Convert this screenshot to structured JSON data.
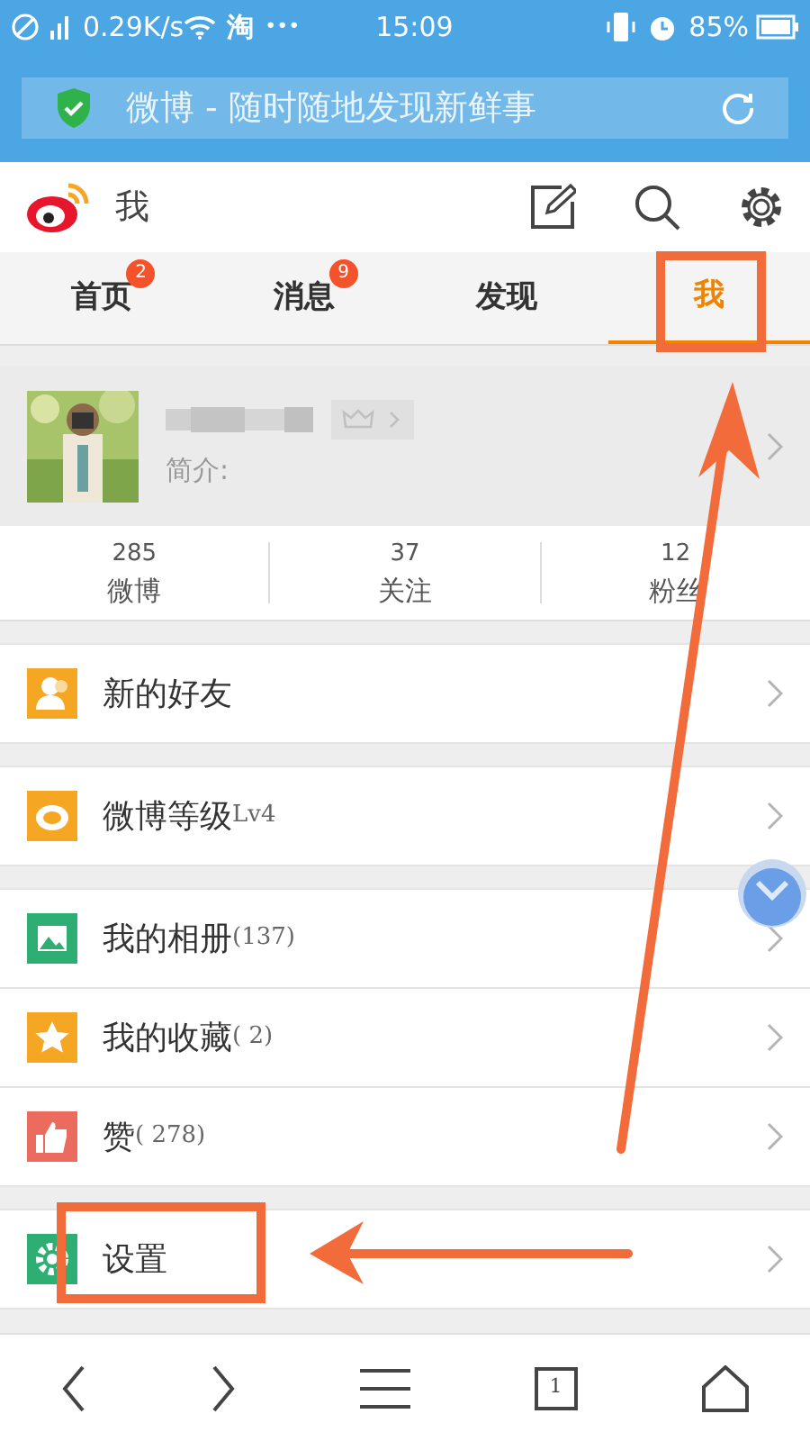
{
  "status_bar": {
    "speed": "0.29K/s",
    "app": "淘",
    "more": "•••",
    "time": "15:09",
    "battery": "85%"
  },
  "address_bar": {
    "title": "微博 - 随时随地发现新鲜事"
  },
  "header": {
    "title": "我"
  },
  "tabs": [
    {
      "label": "首页",
      "badge": "2",
      "selected": false
    },
    {
      "label": "消息",
      "badge": "9",
      "selected": false
    },
    {
      "label": "发现",
      "selected": false
    },
    {
      "label": "我",
      "selected": true
    }
  ],
  "profile": {
    "bio": "简介:"
  },
  "stats": [
    {
      "count": "285",
      "label": "微博"
    },
    {
      "count": "37",
      "label": "关注"
    },
    {
      "count": "12",
      "label": "粉丝"
    }
  ],
  "menu_groups": [
    [
      {
        "kind": "friends",
        "label": "新的好友"
      }
    ],
    [
      {
        "kind": "level",
        "label": "微博等级",
        "suffix": "Lv4"
      }
    ],
    [
      {
        "kind": "album",
        "label": "我的相册",
        "suffix": "(137)"
      },
      {
        "kind": "favorite",
        "label": "我的收藏",
        "suffix": "( 2)"
      },
      {
        "kind": "like",
        "label": "赞",
        "suffix": "( 278)"
      }
    ],
    [
      {
        "kind": "settings",
        "label": "设置"
      }
    ]
  ],
  "bottom_nav": {
    "page_count": "1"
  }
}
